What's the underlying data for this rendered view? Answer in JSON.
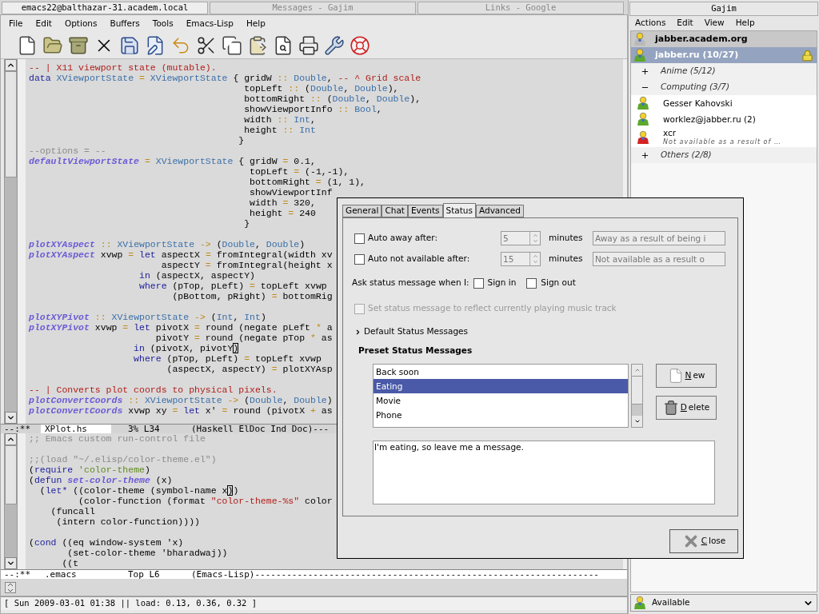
{
  "window_tabs": [
    {
      "title": "emacs22@balthazar-31.academ.local",
      "selected": true
    },
    {
      "title": "Messages - Gajim",
      "selected": false
    },
    {
      "title": "Links - Google",
      "selected": false
    }
  ],
  "emacs": {
    "menu": [
      "File",
      "Edit",
      "Options",
      "Buffers",
      "Tools",
      "Emacs-Lisp",
      "Help"
    ],
    "panes": [
      {
        "lines": [
          {
            "kind": "code",
            "segments": [
              {
                "kind": "doc",
                "text": "-- | X11 viewport state (mutable)."
              }
            ]
          },
          {
            "kind": "code",
            "segments": [
              {
                "kind": "kw",
                "text": "data"
              },
              {
                "kind": "type",
                "text": " XViewportState"
              },
              {
                "kind": "op",
                "text": " = "
              },
              {
                "kind": "type",
                "text": "XViewportState"
              },
              {
                "kind": "plain",
                "text": " { gridW "
              },
              {
                "kind": "op",
                "text": "::"
              },
              {
                "kind": "type",
                "text": " Double"
              },
              {
                "kind": "plain",
                "text": ", "
              },
              {
                "kind": "doc",
                "text": "-- ^ Grid scale"
              }
            ]
          },
          {
            "kind": "code",
            "segments": [
              {
                "kind": "plain",
                "text": "                                       topLeft "
              },
              {
                "kind": "op",
                "text": "::"
              },
              {
                "kind": "plain",
                "text": " ("
              },
              {
                "kind": "type",
                "text": "Double"
              },
              {
                "kind": "plain",
                "text": ", "
              },
              {
                "kind": "type",
                "text": "Double"
              },
              {
                "kind": "plain",
                "text": "),"
              }
            ]
          },
          {
            "kind": "code",
            "segments": [
              {
                "kind": "plain",
                "text": "                                       bottomRight "
              },
              {
                "kind": "op",
                "text": "::"
              },
              {
                "kind": "plain",
                "text": " ("
              },
              {
                "kind": "type",
                "text": "Double"
              },
              {
                "kind": "plain",
                "text": ", "
              },
              {
                "kind": "type",
                "text": "Double"
              },
              {
                "kind": "plain",
                "text": "),"
              }
            ]
          },
          {
            "kind": "code",
            "segments": [
              {
                "kind": "plain",
                "text": "                                       showViewportInfo "
              },
              {
                "kind": "op",
                "text": "::"
              },
              {
                "kind": "type",
                "text": " Bool"
              },
              {
                "kind": "plain",
                "text": ","
              }
            ]
          },
          {
            "kind": "code",
            "segments": [
              {
                "kind": "plain",
                "text": "                                       width "
              },
              {
                "kind": "op",
                "text": "::"
              },
              {
                "kind": "type",
                "text": " Int"
              },
              {
                "kind": "plain",
                "text": ","
              }
            ]
          },
          {
            "kind": "code",
            "segments": [
              {
                "kind": "plain",
                "text": "                                       height "
              },
              {
                "kind": "op",
                "text": "::"
              },
              {
                "kind": "type",
                "text": " Int"
              }
            ]
          },
          {
            "kind": "code",
            "segments": [
              {
                "kind": "plain",
                "text": "                                      }"
              }
            ]
          },
          {
            "kind": "code",
            "segments": [
              {
                "kind": "cmt",
                "text": "--options = --"
              }
            ]
          },
          {
            "kind": "code",
            "segments": [
              {
                "kind": "fn",
                "text": "defaultViewportState"
              },
              {
                "kind": "op",
                "text": " = "
              },
              {
                "kind": "type",
                "text": "XViewportState"
              },
              {
                "kind": "plain",
                "text": " { gridW "
              },
              {
                "kind": "op",
                "text": "="
              },
              {
                "kind": "plain",
                "text": " 0.1,"
              }
            ]
          },
          {
            "kind": "code",
            "segments": [
              {
                "kind": "plain",
                "text": "                                        topLeft "
              },
              {
                "kind": "op",
                "text": "="
              },
              {
                "kind": "plain",
                "text": " (-1,-1),"
              }
            ]
          },
          {
            "kind": "code",
            "segments": [
              {
                "kind": "plain",
                "text": "                                        bottomRight "
              },
              {
                "kind": "op",
                "text": "="
              },
              {
                "kind": "plain",
                "text": " (1, 1),"
              }
            ]
          },
          {
            "kind": "code",
            "segments": [
              {
                "kind": "plain",
                "text": "                                        showViewportInf"
              }
            ]
          },
          {
            "kind": "code",
            "segments": [
              {
                "kind": "plain",
                "text": "                                        width "
              },
              {
                "kind": "op",
                "text": "="
              },
              {
                "kind": "plain",
                "text": " 320,"
              }
            ]
          },
          {
            "kind": "code",
            "segments": [
              {
                "kind": "plain",
                "text": "                                        height "
              },
              {
                "kind": "op",
                "text": "="
              },
              {
                "kind": "plain",
                "text": " 240"
              }
            ]
          },
          {
            "kind": "code",
            "segments": [
              {
                "kind": "plain",
                "text": "                                       }"
              }
            ]
          },
          {
            "kind": "blank"
          },
          {
            "kind": "code",
            "segments": [
              {
                "kind": "fn",
                "text": "plotXYAspect"
              },
              {
                "kind": "op",
                "text": " :: "
              },
              {
                "kind": "type",
                "text": "XViewportState"
              },
              {
                "kind": "op",
                "text": " -> "
              },
              {
                "kind": "plain",
                "text": "("
              },
              {
                "kind": "type",
                "text": "Double"
              },
              {
                "kind": "plain",
                "text": ", "
              },
              {
                "kind": "type",
                "text": "Double"
              },
              {
                "kind": "plain",
                "text": ")"
              }
            ]
          },
          {
            "kind": "code",
            "segments": [
              {
                "kind": "fn",
                "text": "plotXYAspect"
              },
              {
                "kind": "plain",
                "text": " xvwp "
              },
              {
                "kind": "op",
                "text": "="
              },
              {
                "kind": "kw",
                "text": " let"
              },
              {
                "kind": "plain",
                "text": " aspectX "
              },
              {
                "kind": "op",
                "text": "="
              },
              {
                "kind": "plain",
                "text": " fromIntegral(width xv"
              }
            ]
          },
          {
            "kind": "code",
            "segments": [
              {
                "kind": "plain",
                "text": "                        aspectY "
              },
              {
                "kind": "op",
                "text": "="
              },
              {
                "kind": "plain",
                "text": " fromIntegral(height x"
              }
            ]
          },
          {
            "kind": "code",
            "segments": [
              {
                "kind": "kw",
                "text": "                    in"
              },
              {
                "kind": "plain",
                "text": " (aspectX, aspectY)"
              }
            ]
          },
          {
            "kind": "code",
            "segments": [
              {
                "kind": "kw",
                "text": "                    where"
              },
              {
                "kind": "plain",
                "text": " (pTop, pLeft) "
              },
              {
                "kind": "op",
                "text": "="
              },
              {
                "kind": "plain",
                "text": " topLeft xvwp"
              }
            ]
          },
          {
            "kind": "code",
            "segments": [
              {
                "kind": "plain",
                "text": "                          (pBottom, pRight) "
              },
              {
                "kind": "op",
                "text": "="
              },
              {
                "kind": "plain",
                "text": " bottomRig"
              }
            ]
          },
          {
            "kind": "blank"
          },
          {
            "kind": "code",
            "segments": [
              {
                "kind": "fn",
                "text": "plotXYPivot"
              },
              {
                "kind": "op",
                "text": " :: "
              },
              {
                "kind": "type",
                "text": "XViewportState"
              },
              {
                "kind": "op",
                "text": " -> "
              },
              {
                "kind": "plain",
                "text": "("
              },
              {
                "kind": "type",
                "text": "Int"
              },
              {
                "kind": "plain",
                "text": ", "
              },
              {
                "kind": "type",
                "text": "Int"
              },
              {
                "kind": "plain",
                "text": ")"
              }
            ]
          },
          {
            "kind": "code",
            "segments": [
              {
                "kind": "fn",
                "text": "plotXYPivot"
              },
              {
                "kind": "plain",
                "text": " xvwp "
              },
              {
                "kind": "op",
                "text": "="
              },
              {
                "kind": "kw",
                "text": " let"
              },
              {
                "kind": "plain",
                "text": " pivotX "
              },
              {
                "kind": "op",
                "text": "="
              },
              {
                "kind": "plain",
                "text": " round (negate pLeft "
              },
              {
                "kind": "op",
                "text": "*"
              },
              {
                "kind": "plain",
                "text": " a"
              }
            ]
          },
          {
            "kind": "code",
            "segments": [
              {
                "kind": "plain",
                "text": "                       pivotY "
              },
              {
                "kind": "op",
                "text": "="
              },
              {
                "kind": "plain",
                "text": " round (negate pTop "
              },
              {
                "kind": "op",
                "text": "*"
              },
              {
                "kind": "plain",
                "text": " as"
              }
            ]
          },
          {
            "kind": "code",
            "segments": [
              {
                "kind": "kw",
                "text": "                   in"
              },
              {
                "kind": "plain",
                "text": " (pivotX, pivotY"
              },
              {
                "kind": "cursor",
                "text": ")"
              }
            ]
          },
          {
            "kind": "code",
            "segments": [
              {
                "kind": "kw",
                "text": "                   where"
              },
              {
                "kind": "plain",
                "text": " (pTop, pLeft) "
              },
              {
                "kind": "op",
                "text": "="
              },
              {
                "kind": "plain",
                "text": " topLeft xvwp"
              }
            ]
          },
          {
            "kind": "code",
            "segments": [
              {
                "kind": "plain",
                "text": "                         (aspectX, aspectY) "
              },
              {
                "kind": "op",
                "text": "="
              },
              {
                "kind": "plain",
                "text": " plotXYAsp"
              }
            ]
          },
          {
            "kind": "blank"
          },
          {
            "kind": "code",
            "segments": [
              {
                "kind": "doc",
                "text": "-- | Converts plot coords to physical pixels."
              }
            ]
          },
          {
            "kind": "code",
            "segments": [
              {
                "kind": "fn",
                "text": "plotConvertCoords"
              },
              {
                "kind": "op",
                "text": " :: "
              },
              {
                "kind": "type",
                "text": "XViewportState"
              },
              {
                "kind": "op",
                "text": " -> "
              },
              {
                "kind": "plain",
                "text": "("
              },
              {
                "kind": "type",
                "text": "Double"
              },
              {
                "kind": "plain",
                "text": ", "
              },
              {
                "kind": "type",
                "text": "Double"
              },
              {
                "kind": "plain",
                "text": ")"
              }
            ]
          },
          {
            "kind": "code",
            "segments": [
              {
                "kind": "fn",
                "text": "plotConvertCoords"
              },
              {
                "kind": "plain",
                "text": " xvwp xy "
              },
              {
                "kind": "op",
                "text": "="
              },
              {
                "kind": "kw",
                "text": " let"
              },
              {
                "kind": "plain",
                "text": " x' "
              },
              {
                "kind": "op",
                "text": "="
              },
              {
                "kind": "plain",
                "text": " round (pivotX "
              },
              {
                "kind": "op",
                "text": "+"
              },
              {
                "kind": "plain",
                "text": " as"
              }
            ]
          }
        ],
        "modeline": {
          "active": false,
          "status": "--:**",
          "buffer": "XPlot.hs",
          "position": "3% L34",
          "mode": "(Haskell ElDoc Ind Doc)---"
        }
      },
      {
        "lines": [
          {
            "kind": "code",
            "segments": [
              {
                "kind": "cmt",
                "text": ";; Emacs custom run-control file"
              }
            ]
          },
          {
            "kind": "blank"
          },
          {
            "kind": "code",
            "segments": [
              {
                "kind": "cmt",
                "text": ";;(load \"~/.elisp/color-theme.el\")"
              }
            ]
          },
          {
            "kind": "code",
            "segments": [
              {
                "kind": "plain",
                "text": "("
              },
              {
                "kind": "kw",
                "text": "require"
              },
              {
                "kind": "const",
                "text": " 'color-theme"
              },
              {
                "kind": "plain",
                "text": ")"
              }
            ]
          },
          {
            "kind": "code",
            "segments": [
              {
                "kind": "plain",
                "text": "("
              },
              {
                "kind": "kw",
                "text": "defun"
              },
              {
                "kind": "fn",
                "text": " set-color-theme"
              },
              {
                "kind": "plain",
                "text": " (x)"
              }
            ]
          },
          {
            "kind": "code",
            "segments": [
              {
                "kind": "plain",
                "text": "  ("
              },
              {
                "kind": "kw",
                "text": "let*"
              },
              {
                "kind": "plain",
                "text": " ((color-theme (symbol-name x"
              },
              {
                "kind": "cursor",
                "text": ")"
              },
              {
                "kind": "plain",
                "text": ")"
              }
            ]
          },
          {
            "kind": "code",
            "segments": [
              {
                "kind": "plain",
                "text": "         (color-function (format "
              },
              {
                "kind": "str",
                "text": "\"color-theme-%s\""
              },
              {
                "kind": "plain",
                "text": " color"
              }
            ]
          },
          {
            "kind": "code",
            "segments": [
              {
                "kind": "plain",
                "text": "    (funcall"
              }
            ]
          },
          {
            "kind": "code",
            "segments": [
              {
                "kind": "plain",
                "text": "     (intern color-function))))"
              }
            ]
          },
          {
            "kind": "blank"
          },
          {
            "kind": "code",
            "segments": [
              {
                "kind": "plain",
                "text": "("
              },
              {
                "kind": "kw",
                "text": "cond"
              },
              {
                "kind": "plain",
                "text": " ((eq window-system 'x)"
              }
            ]
          },
          {
            "kind": "code",
            "segments": [
              {
                "kind": "plain",
                "text": "       (set-color-theme 'bharadwaj))"
              }
            ]
          },
          {
            "kind": "code",
            "segments": [
              {
                "kind": "plain",
                "text": "      ((t"
              }
            ]
          }
        ],
        "modeline": {
          "active": true,
          "status": "--:**",
          "buffer": ".emacs",
          "position": "Top L6",
          "mode": "(Emacs-Lisp)-----------------------------------------------------------------"
        }
      }
    ],
    "status_line": "[ Sun 2009-03-01 01:38 || load: 0.13, 0.36, 0.32 ]"
  },
  "roster": {
    "title": "Gajim",
    "menu": [
      "Actions",
      "Edit",
      "View",
      "Help"
    ],
    "accounts": [
      {
        "name": "jabber.academ.org",
        "color": "#b9b9b9",
        "selected": false,
        "locked": false
      },
      {
        "name": "jabber.ru (10/27)",
        "color": "#5ca82a",
        "selected": true,
        "locked": true,
        "children": [
          {
            "name": "Anime (5/12)",
            "expanded": false
          },
          {
            "name": "Computing (3/7)",
            "expanded": true,
            "children": [
              {
                "name": "Gesser Kahovski",
                "color": "#5ca82a"
              },
              {
                "name": "worklez@jabber.ru (2)",
                "color": "#5ca82a"
              },
              {
                "name": "xcr",
                "color": "#d42222",
                "message": "Not available as a result of …"
              }
            ]
          },
          {
            "name": "Others (2/8)",
            "expanded": false
          }
        ]
      }
    ],
    "status_selector": {
      "value": "Available",
      "color": "#5ca82a"
    }
  },
  "dialog": {
    "tabs": [
      {
        "label": "General",
        "selected": false
      },
      {
        "label": "Chat",
        "selected": false
      },
      {
        "label": "Events",
        "selected": false
      },
      {
        "label": "Status",
        "selected": true
      },
      {
        "label": "Advanced",
        "selected": false
      }
    ],
    "auto_rows": [
      {
        "label": "Auto away after:",
        "checked": false,
        "minutes": "5",
        "unit": "minutes",
        "message": "Away as a result of being i"
      },
      {
        "label": "Auto not available after:",
        "checked": false,
        "minutes": "15",
        "unit": "minutes",
        "message": "Not available as a result o"
      }
    ],
    "ask": {
      "label": "Ask status message when I:",
      "options": [
        {
          "label": "Sign in",
          "checked": false
        },
        {
          "label": "Sign out",
          "checked": false
        }
      ]
    },
    "music": {
      "label": "Set status message to reflect currently playing music track",
      "checked": false,
      "disabled": true
    },
    "default_messages": {
      "label": "Default Status Messages",
      "expanded": false
    },
    "preset": {
      "heading": "Preset Status Messages",
      "items": [
        {
          "label": "Back soon",
          "selected": false
        },
        {
          "label": "Eating",
          "selected": true
        },
        {
          "label": "Movie",
          "selected": false
        },
        {
          "label": "Phone",
          "selected": false
        }
      ],
      "buttons": [
        {
          "label": "New",
          "kind": "new"
        },
        {
          "label": "Delete",
          "kind": "delete"
        }
      ],
      "message": "I'm eating, so leave me a message."
    },
    "close": "Close"
  }
}
